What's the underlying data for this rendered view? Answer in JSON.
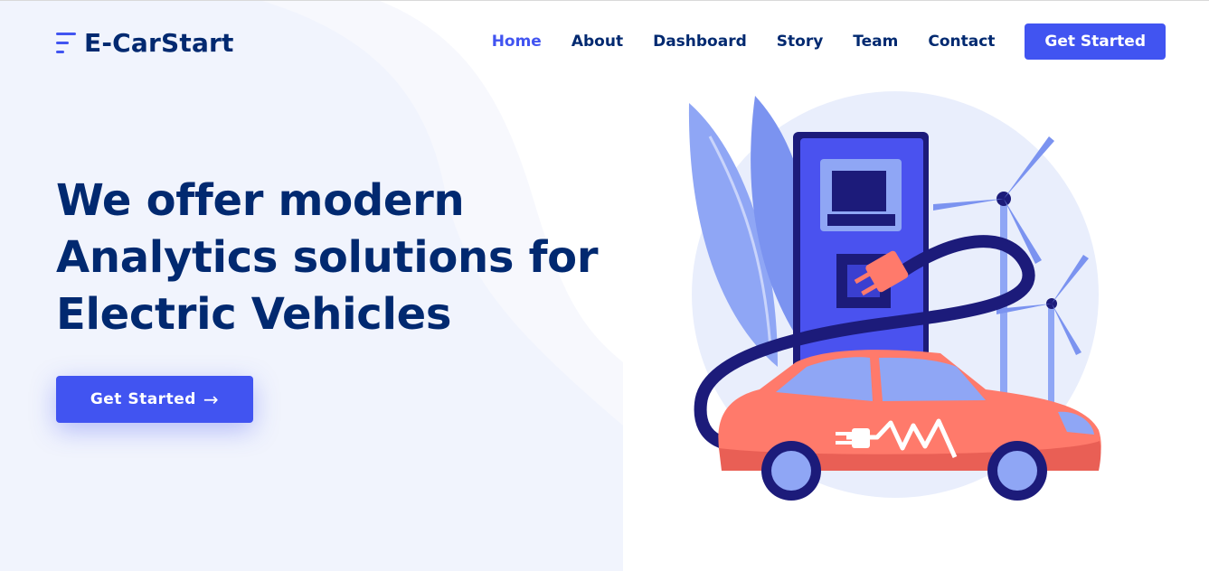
{
  "brand": {
    "name": "E-CarStart",
    "colors": {
      "primary": "#4154f1",
      "dark": "#012970",
      "car": "#ff7a6b",
      "sky": "#e9eefc"
    }
  },
  "nav": {
    "items": [
      {
        "label": "Home",
        "active": true
      },
      {
        "label": "About"
      },
      {
        "label": "Dashboard"
      },
      {
        "label": "Story"
      },
      {
        "label": "Team"
      },
      {
        "label": "Contact"
      }
    ],
    "cta_label": "Get Started"
  },
  "hero": {
    "title_lines": [
      "We offer modern",
      "Analytics solutions for",
      "Electric Vehicles"
    ],
    "button_label": "Get Started",
    "button_icon": "arrow-right-icon"
  }
}
